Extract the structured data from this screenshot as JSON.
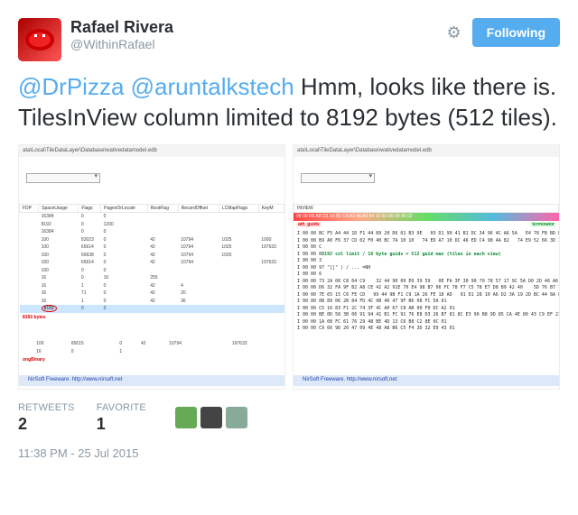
{
  "user": {
    "name": "Rafael Rivera",
    "handle": "@WithinRafael"
  },
  "follow": "Following",
  "mentions": [
    "@DrPizza",
    "@aruntalkstech"
  ],
  "tweet_rest": "Hmm, looks like there is. TilesInView column limited to 8192 bytes (512 tiles).",
  "pathbar": "ata\\Local\\TileDataLayer\\Database\\wativedatamodel.edb",
  "table1": {
    "cols": [
      "FDP",
      "SpaceUsage",
      "Flags",
      "PagesOrLocale",
      "RootFlag",
      "RecordOffset",
      "LCMapFlags",
      "KeyM"
    ],
    "rows": [
      [
        "",
        "16384",
        "0",
        "0",
        "",
        "",
        "",
        ""
      ],
      [
        "",
        "8192",
        "0",
        "1200",
        "",
        "",
        "",
        ""
      ],
      [
        "",
        "16384",
        "0",
        "0",
        "",
        "",
        "",
        ""
      ],
      [
        "",
        "100",
        "83023",
        "0",
        "42",
        "10794",
        "1025",
        "1000"
      ],
      [
        "",
        "100",
        "65614",
        "0",
        "42",
        "10794",
        "1025",
        "197633"
      ],
      [
        "",
        "100",
        "66638",
        "0",
        "42",
        "10794",
        "1025",
        ""
      ],
      [
        "",
        "100",
        "65614",
        "0",
        "42",
        "10794",
        "",
        "197633"
      ],
      [
        "",
        "100",
        "0",
        "0",
        "",
        "",
        "",
        ""
      ],
      [
        "",
        "16",
        "0",
        "16",
        "255",
        "",
        "",
        ""
      ],
      [
        "",
        "16",
        "1",
        "0",
        "42",
        "4",
        "",
        ""
      ],
      [
        "",
        "16",
        "71",
        "0",
        "42",
        "20",
        "",
        ""
      ],
      [
        "",
        "16",
        "1",
        "0",
        "42",
        "36",
        "",
        ""
      ]
    ],
    "hlrow": [
      "",
      "8192",
      "0",
      "0",
      "",
      "",
      "",
      ""
    ],
    "postrows": [
      [
        "",
        "100",
        "65615",
        "0",
        "42",
        "10794",
        "",
        "197633"
      ],
      [
        "",
        "16",
        "0",
        "1",
        "",
        "",
        "",
        ""
      ]
    ],
    "bytes": "8192 bytes",
    "binary": "ongBinary"
  },
  "nirsoft": "NirSoft Freeware.  http://www.nirsoft.net",
  "shot2": {
    "col": "INVIEW",
    "hdr": "90 00 D6 A8 C9 14 0E CA A2 46 A0 64 10 00 D6 00 86 02",
    "row_guids_lbl": "ath_guids",
    "row_term": "terminator",
    "rows": [
      "I 00 00 BC F5 A4 44 1D F1 44 89 20 D6 01 B3 9E   03 D1 99 41 B1 DC 34 96 4C A6 5A   E4 78 FB BD FA 3F 7",
      "I 00 00 B9 A0 F6 37 CD 02 F0 40 BC 7A 10 10   74 ED A7 10 DC 46 ED C4 98 4A 82   74 E9 52 66 3D 18 01",
      "I 00 00 C",
      "I 00 00 08192 col limit / 16 byte guids = 512 guid max (tiles in each view)",
      "I 00 00 3",
      "I 00 00 97 \"[]\" ) / ... =NH",
      "I 00 00 6",
      "I 00 00 73 2A 00 C8 04 C9    32 44 90 09 E0 39 59   0E FA 3F 30 90 70 78 57 17 9C 5A D0 2D 46 A6 53 59 65 CC 99",
      "I 00 00 D6 32 FA 9F B2 A8 CE 42 A2 91E 70 E4 98 B7 06 FC 78 F7 C5 78 E7 D8 B9 42 40    5D 76 B7 71 7A 24 95",
      "I 00 00 7E 65 15 C6 FE CD   99 44 9B F1 C9 1A 26 FE 18 AD   91 D1 28 10 A6 D2 3A 19 2D BC 44 8A 89 B8 DA 18 4",
      "I 00 00 0B 89 06 2B 84 FD 4C 9B 46 47 9F B6 08 FC 5A 01",
      "I 00 00 C5 16 83 F1 2C 74 3F 4C A0 67 C8 AB 00 F0 DC A2 01",
      "I 00 00 BE 0D 58 3B 06 91 94 41 B1 FC 91 76 E8 D3 26 B7 81 8C E3 90 B8 9D 85 CA 4E 80 43 C9 EF 23 7F 71 B1",
      "I 00 00 1A 08 FC 61 76 29 48 BE 4D 13 C6 B8 C2 8E 0C 01",
      "I 00 00 C9 66 9D 20 47 09 4E 48 A8 B6 C5 F4 3D 32 E9 43 01"
    ]
  },
  "stats": {
    "rt_lbl": "RETWEETS",
    "rt": "2",
    "fav_lbl": "FAVORITE",
    "fav": "1"
  },
  "timestamp": "11:38 PM - 25 Jul 2015"
}
